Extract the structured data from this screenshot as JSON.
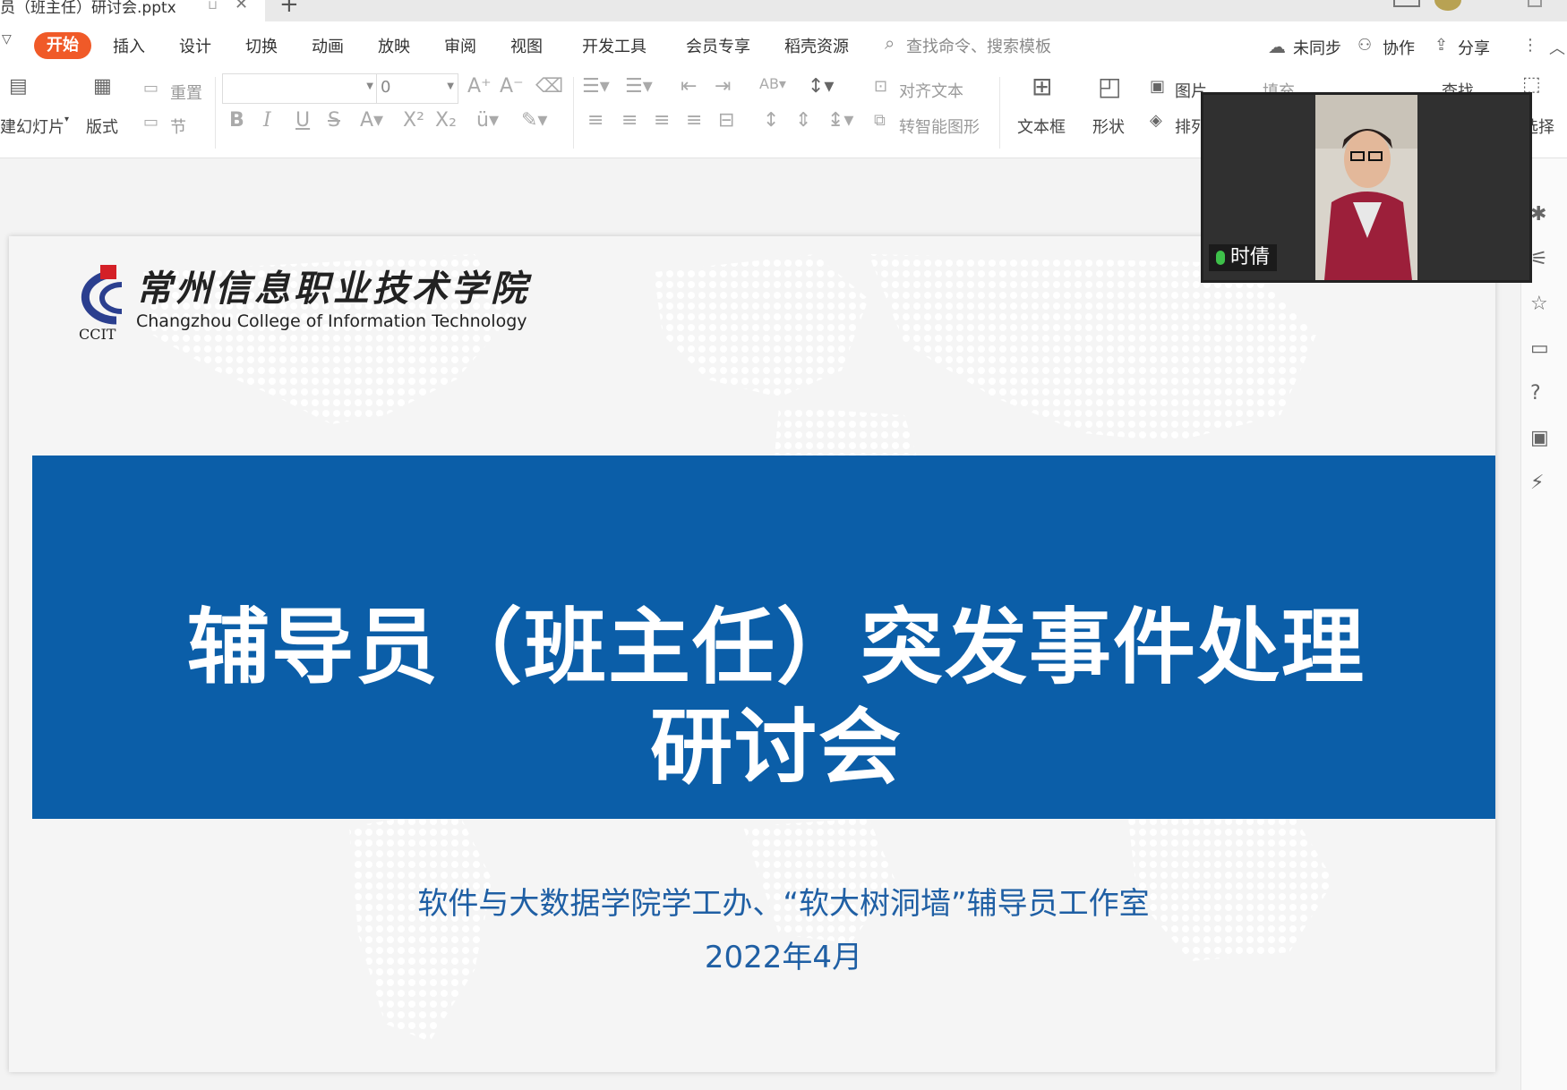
{
  "window": {
    "tab_title": "员（班主任）研讨会.pptx",
    "new_tab": "+"
  },
  "menu": {
    "start": "开始",
    "items": [
      "插入",
      "设计",
      "切换",
      "动画",
      "放映",
      "审阅",
      "视图",
      "开发工具",
      "会员专享",
      "稻壳资源"
    ],
    "search_placeholder": "查找命令、搜索模板",
    "unsynced": "未同步",
    "collaborate": "协作",
    "share": "分享"
  },
  "ribbon": {
    "new_slide": "建幻灯片",
    "layout": "版式",
    "reset": "重置",
    "section": "节",
    "font_size_value": "0",
    "align_text": "对齐文本",
    "smart_art": "转智能图形",
    "text_box": "文本框",
    "shape": "形状",
    "picture": "图片",
    "arrange": "排列",
    "fill": "填充",
    "find": "查找",
    "select": "选择"
  },
  "slide": {
    "logo_cn": "常州信息职业技术学院",
    "logo_en": "Changzhou College of Information Technology",
    "logo_abbr": "CCIT",
    "title_line1": "辅导员（班主任）突发事件处理",
    "title_line2": "研讨会",
    "subtitle": "软件与大数据学院学工办、“软大树洞墙”辅导员工作室",
    "date": "2022年4月"
  },
  "video": {
    "participant_name": "时倩"
  },
  "colors": {
    "accent_orange": "#f05a28",
    "banner_blue": "#0b5ea8",
    "subtitle_blue": "#1f5fa4",
    "mic_green": "#3ec14a"
  }
}
